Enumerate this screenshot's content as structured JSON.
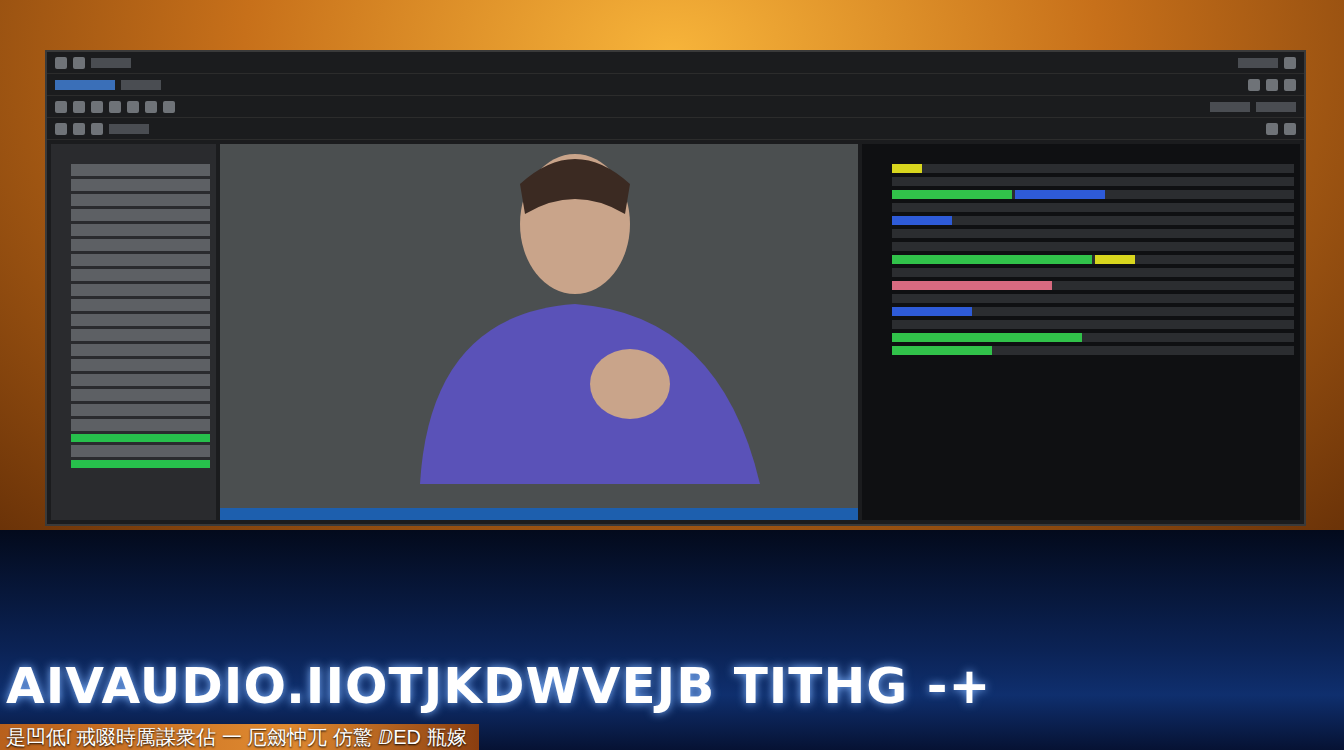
{
  "banner": {
    "title": "AIVAUDIO.IIOTJKDWVEJB TITHG -+",
    "subtitle": "是凹低ſ 戒啜時厲謀衆佔 一 厄劔忡兀 仿驚 ⅅED 瓶嫁"
  }
}
